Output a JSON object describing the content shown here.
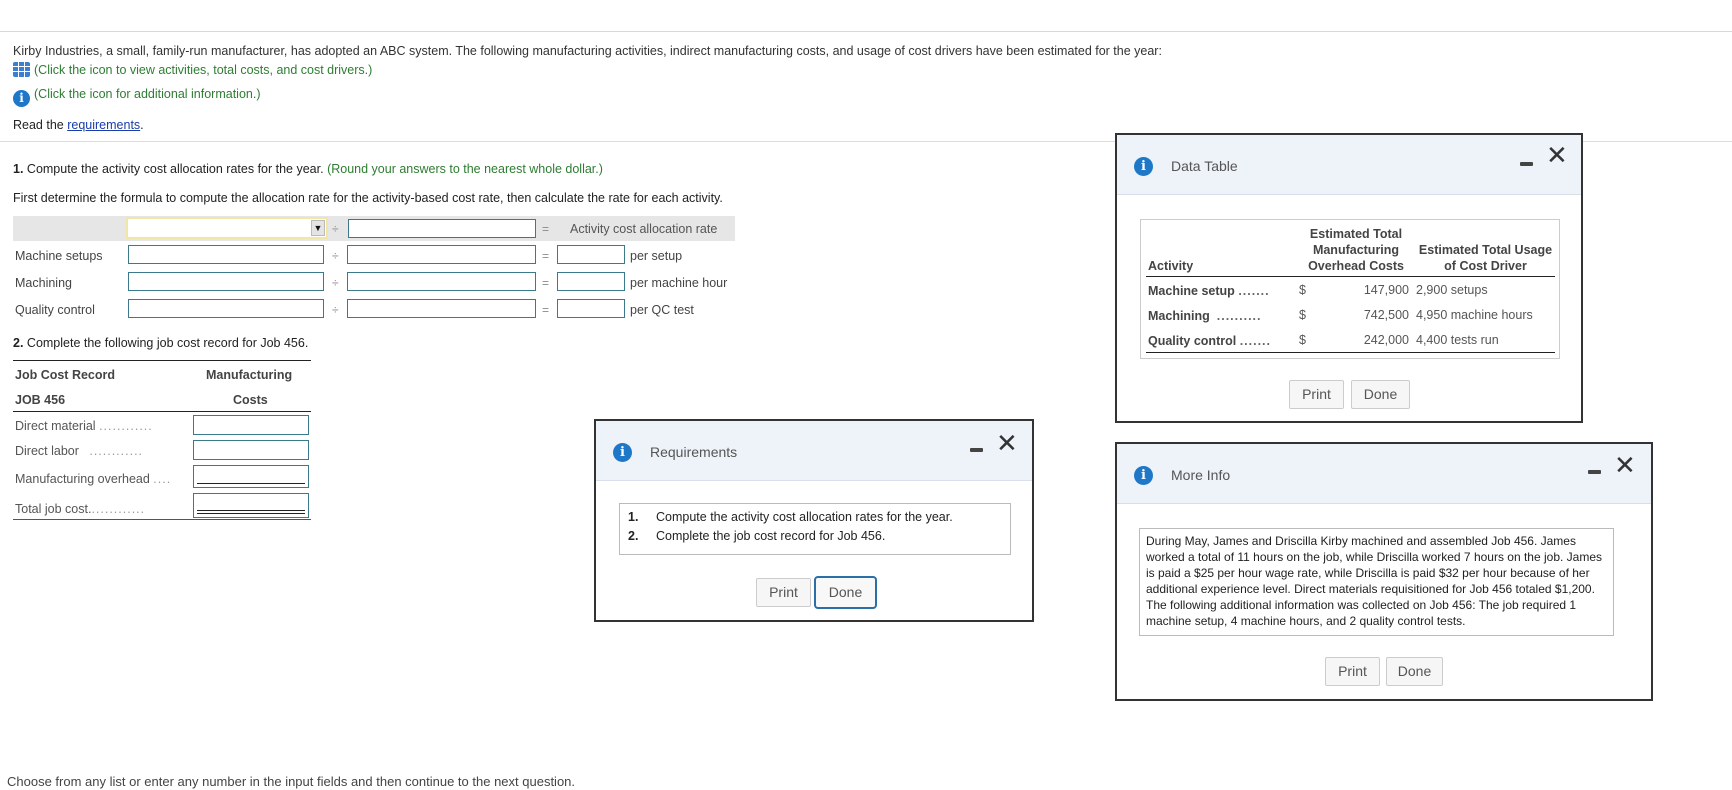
{
  "intro": {
    "text": "Kirby Industries, a small, family-run manufacturer, has adopted an ABC system. The following manufacturing activities, indirect manufacturing costs, and usage of cost drivers have been estimated for the year:",
    "data_link": "(Click the icon to view activities, total costs, and cost drivers.)",
    "info_link": "(Click the icon for additional information.)",
    "read_prefix": "Read the ",
    "requirements_link": "requirements",
    "read_suffix": "."
  },
  "part1": {
    "number": "1.",
    "title": " Compute the activity cost allocation rates for the year.",
    "hint": "(Round your answers to the nearest whole dollar.)",
    "instruction": "First determine the formula to compute the allocation rate for the activity-based cost rate, then calculate the rate for each activity.",
    "divide_symbol": "÷",
    "equals_symbol": "=",
    "result_header": "Activity cost allocation rate",
    "formula_select_value": "",
    "formula_divisor_value": "",
    "rows": [
      {
        "label": "Machine setups",
        "numerator": "",
        "denominator": "",
        "rate": "",
        "unit": "per setup"
      },
      {
        "label": "Machining",
        "numerator": "",
        "denominator": "",
        "rate": "",
        "unit": "per machine hour"
      },
      {
        "label": "Quality control",
        "numerator": "",
        "denominator": "",
        "rate": "",
        "unit": "per QC test"
      }
    ]
  },
  "part2": {
    "number": "2.",
    "title": " Complete the following job cost record for Job 456.",
    "header_left_1": "Job Cost Record",
    "header_left_2": "JOB 456",
    "header_right_1": "Manufacturing",
    "header_right_2": "Costs",
    "rows": [
      {
        "label": "Direct material",
        "dots": "............",
        "value": ""
      },
      {
        "label": "Direct labor",
        "dots": "............",
        "value": ""
      },
      {
        "label": "Manufacturing overhead",
        "dots": "....",
        "value": ""
      },
      {
        "label": "Total job cost.",
        "dots": "............",
        "value": ""
      }
    ]
  },
  "footer": {
    "text": "Choose from any list or enter any number in the input fields and then continue to the next question."
  },
  "dialogs": {
    "requirements": {
      "title": "Requirements",
      "items": [
        {
          "num": "1.",
          "text": "Compute the activity cost allocation rates for the year."
        },
        {
          "num": "2.",
          "text": "Complete the job cost record for Job 456."
        }
      ],
      "print": "Print",
      "done": "Done"
    },
    "data_table": {
      "title": "Data Table",
      "col_activity": "Activity",
      "col_costs_1": "Estimated Total",
      "col_costs_2": "Manufacturing",
      "col_costs_3": "Overhead Costs",
      "col_usage_1": "Estimated Total Usage",
      "col_usage_2": "of Cost Driver",
      "rows": [
        {
          "activity": "Machine setup",
          "dots": ".......",
          "currency": "$",
          "cost": "147,900",
          "usage": "2,900 setups"
        },
        {
          "activity": "Machining",
          "dots": "..........",
          "currency": "$",
          "cost": "742,500",
          "usage": "4,950 machine hours"
        },
        {
          "activity": "Quality control",
          "dots": ".......",
          "currency": "$",
          "cost": "242,000",
          "usage": "4,400 tests run"
        }
      ],
      "print": "Print",
      "done": "Done"
    },
    "more_info": {
      "title": "More Info",
      "text": "During May, James and Driscilla Kirby machined and assembled Job 456. James worked a total of 11 hours on the job, while Driscilla worked 7 hours on the job. James is paid a $25 per hour wage rate, while Driscilla is paid $32 per hour because of her additional experience level. Direct materials requisitioned for Job 456 totaled $1,200. The following additional information was collected on Job 456: The job required 1 machine setup, 4 machine hours, and 2 quality control tests.",
      "print": "Print",
      "done": "Done"
    }
  }
}
